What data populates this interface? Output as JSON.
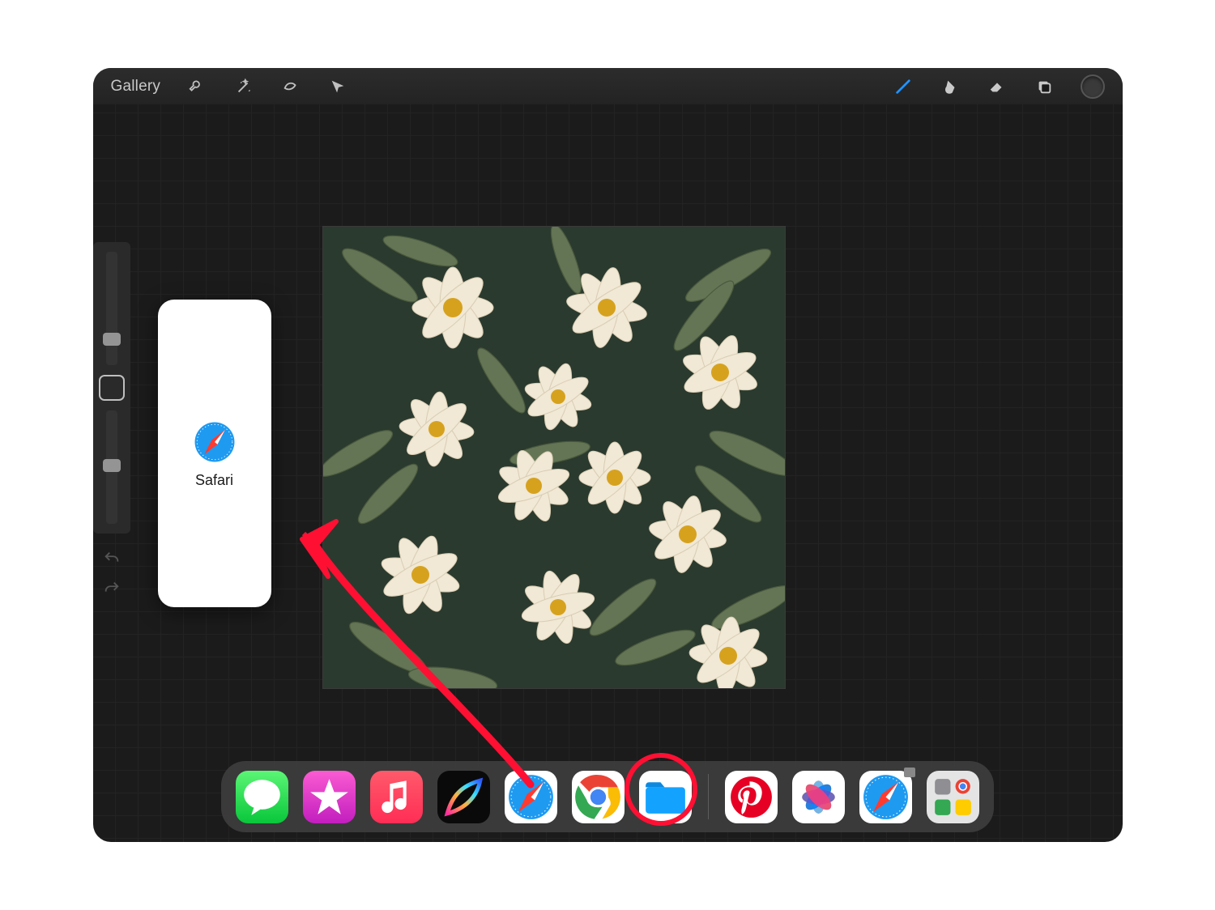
{
  "app": "Procreate",
  "topbar": {
    "gallery_label": "Gallery",
    "tools": [
      "wrench",
      "magic-wand",
      "selection",
      "transform"
    ],
    "right_tools": [
      "brush",
      "smudge",
      "eraser",
      "layers",
      "color"
    ]
  },
  "sidebar": {
    "size_slider": "brush-size",
    "opacity_slider": "brush-opacity",
    "modify_button": "modify",
    "undo": "undo",
    "redo": "redo"
  },
  "split_view": {
    "app_name": "Safari",
    "app_label": "Safari"
  },
  "annotation": {
    "description": "drag Safari from dock to split view"
  },
  "dock": {
    "apps_left": [
      {
        "name": "Messages",
        "icon": "messages"
      },
      {
        "name": "iTunes Store",
        "icon": "itunes-store"
      },
      {
        "name": "Apple Music",
        "icon": "music"
      },
      {
        "name": "Procreate",
        "icon": "procreate"
      },
      {
        "name": "Safari",
        "icon": "safari"
      },
      {
        "name": "Chrome",
        "icon": "chrome"
      },
      {
        "name": "Files",
        "icon": "files"
      }
    ],
    "apps_right": [
      {
        "name": "Pinterest",
        "icon": "pinterest"
      },
      {
        "name": "Photos",
        "icon": "photos"
      },
      {
        "name": "Safari",
        "icon": "safari"
      },
      {
        "name": "App Folder",
        "icon": "folder"
      }
    ]
  }
}
